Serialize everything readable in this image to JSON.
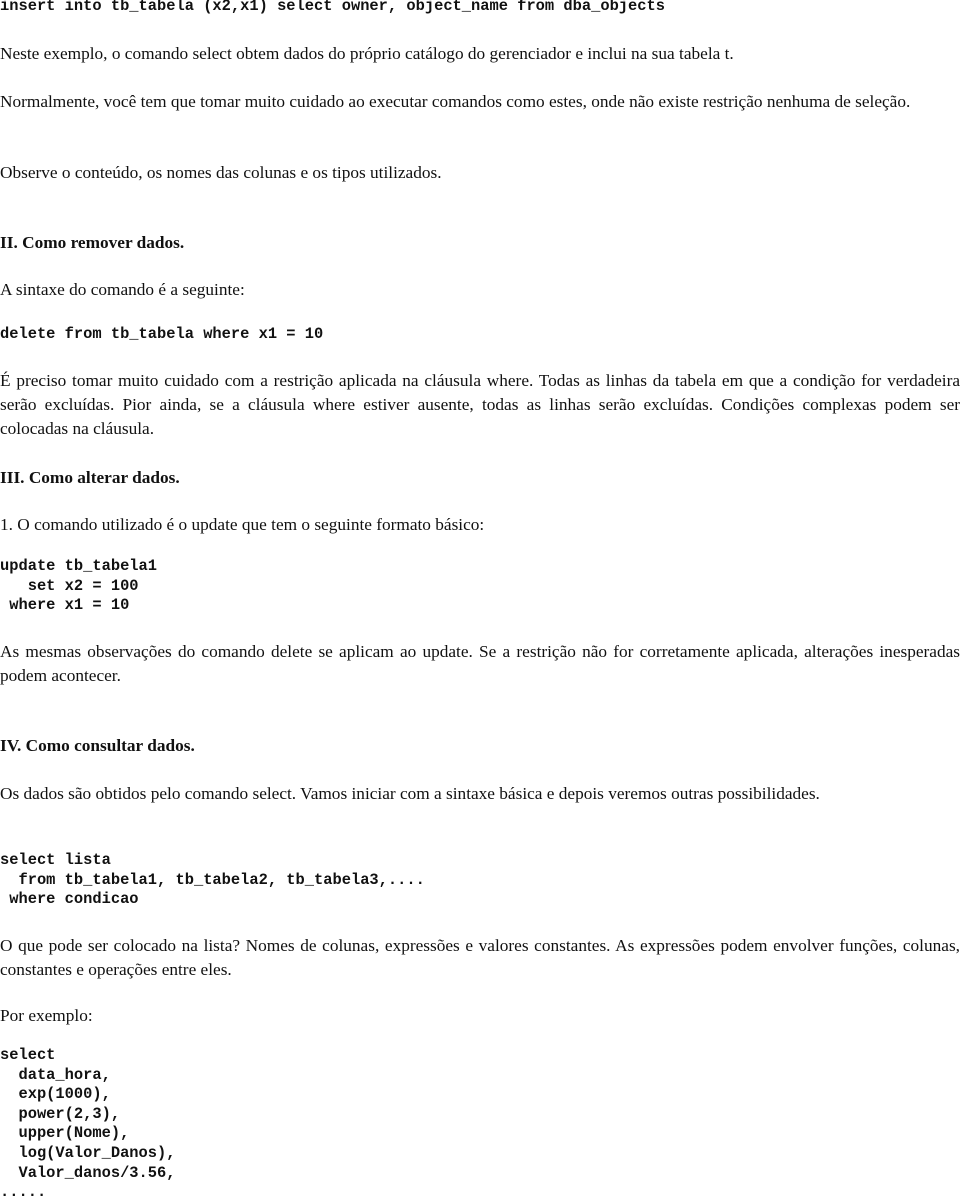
{
  "doc": {
    "code_insert": "insert into tb_tabela (x2,x1) select owner, object_name from dba_objects",
    "p_neste": "Neste exemplo, o comando select  obtem dados do próprio catálogo do gerenciador e inclui na sua tabela t.",
    "p_normalmente": "Normalmente, você tem que tomar muito cuidado ao executar comandos como estes, onde não existe restrição nenhuma de seleção.",
    "p_observe": "Observe o conteúdo, os nomes das colunas e os tipos utilizados.",
    "section2": {
      "heading": "II. Como remover dados.",
      "p_sintaxe": "A sintaxe do comando é a seguinte:",
      "code_delete": "delete from tb_tabela where x1 = 10",
      "p_preciso": "É preciso tomar muito cuidado com a restrição aplicada na cláusula where. Todas as linhas da tabela em que a condição for verdadeira serão excluídas. Pior ainda, se a cláusula where estiver ausente, todas as linhas serão excluídas. Condições complexas podem ser colocadas na cláusula."
    },
    "section3": {
      "heading": "III. Como alterar dados.",
      "p_comando": "1. O comando utilizado é o update que tem o seguinte formato básico:",
      "code_update": [
        "update tb_tabela1",
        "   set x2 = 100",
        " where x1 = 10"
      ],
      "p_mesmas": "As mesmas observações do comando delete se aplicam ao update. Se a restrição não for corretamente aplicada, alterações inesperadas podem acontecer."
    },
    "section4": {
      "heading": "IV. Como consultar dados.",
      "p_dados": "Os dados são obtidos pelo comando select. Vamos iniciar com a sintaxe básica e depois veremos outras possibilidades.",
      "code_select": [
        "select lista",
        "  from tb_tabela1, tb_tabela2, tb_tabela3,....",
        " where condicao"
      ],
      "p_oque": "O que pode ser colocado na lista? Nomes de colunas, expressões e valores constantes. As expressões podem envolver funções, colunas, constantes e operações entre eles.",
      "p_exemplo": "Por exemplo:",
      "code_example": [
        "select",
        "  data_hora,",
        "  exp(1000),",
        "  power(2,3),",
        "  upper(Nome),",
        "  log(Valor_Danos),",
        "  Valor_danos/3.56,",
        "....."
      ]
    }
  }
}
